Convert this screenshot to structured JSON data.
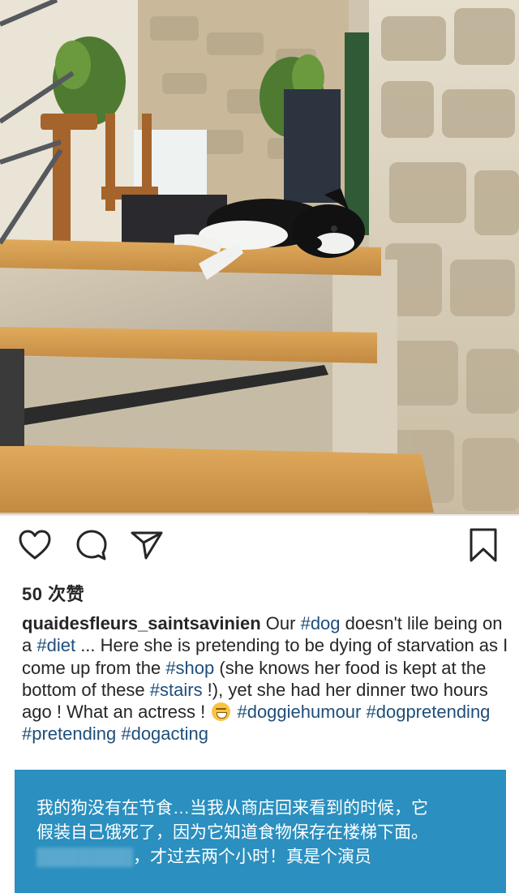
{
  "post": {
    "likes_text": "50 次赞",
    "caption": {
      "username": "quaidesfleurs_saintsavinien",
      "t1": " Our ",
      "tag_dog": "#dog",
      "t2": " doesn't lile being on a ",
      "tag_diet": "#diet",
      "t3": " ... Here she is pretending to  be dying of starvation as I come up from the ",
      "tag_shop": "#shop",
      "t4": " (she knows her food is kept at the bottom of these ",
      "tag_stairs": "#stairs",
      "t5": " !), yet she had  her dinner two hours ago ! What an actress ! ",
      "emoji": "laughing-with-tears",
      "tag_doggiehumour": "#doggiehumour",
      "tag_dogpretending": "#dogpretending",
      "tag_pretending": "#pretending",
      "tag_dogacting": "#dogacting"
    },
    "hashtag_color": "#1f4e7a"
  },
  "translation": {
    "line1": "我的狗没有在节食…当我从商店回来看到的时候，它",
    "line2": "假装自己饿死了，因为它知道食物保存在楼梯下面。",
    "line3_partial": "才过去两个小时！真是个演员",
    "background": "#2b8fbf"
  },
  "icons": {
    "like": "heart-outline-icon",
    "comment": "comment-bubble-icon",
    "share": "paper-plane-icon",
    "save": "bookmark-outline-icon"
  }
}
